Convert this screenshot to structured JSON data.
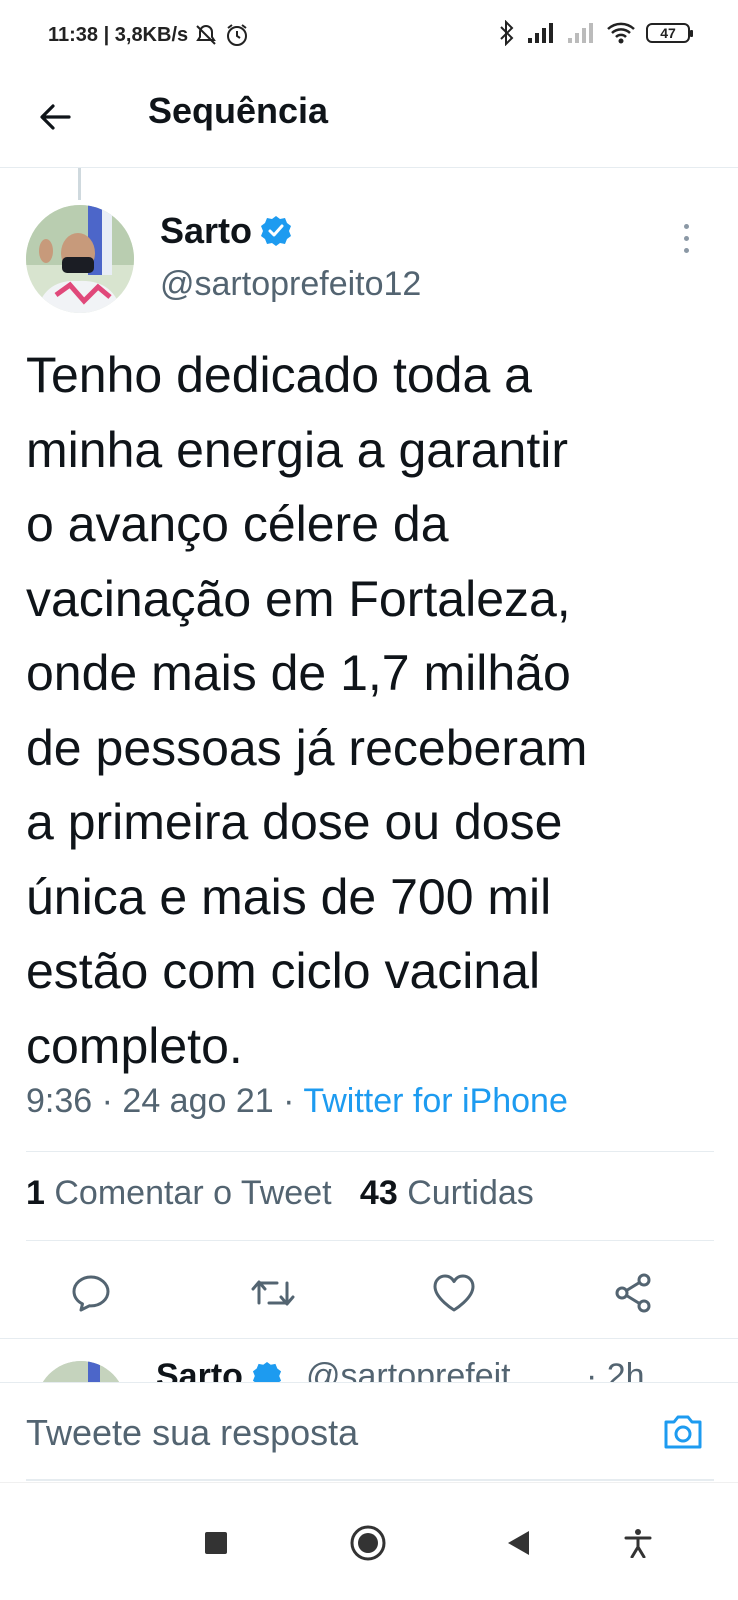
{
  "status_bar": {
    "time_speed": "11:38 | 3,8KB/s",
    "battery": "47"
  },
  "header": {
    "title": "Sequência"
  },
  "tweet": {
    "author_name": "Sarto",
    "author_handle": "@sartoprefeito12",
    "text": "Tenho dedicado toda a minha energia a garantir o avanço célere da vacinação em Fortaleza, onde mais de 1,7 milhão de pessoas já receberam a primeira dose ou dose única e mais de 700 mil estão com ciclo vacinal completo.",
    "lines": [
      "Tenho dedicado toda a",
      "minha energia a garantir",
      "o avanço célere da",
      "vacinação em Fortaleza,",
      "onde mais de 1,7 milhão",
      "de pessoas já receberam",
      "a primeira dose ou dose",
      "única e mais de 700 mil",
      "estão com ciclo vacinal",
      "completo."
    ],
    "time": "9:36",
    "date": "24 ago 21",
    "source": "Twitter for iPhone",
    "separator": "·",
    "replies_count": "1",
    "replies_label": "Comentar o Tweet",
    "likes_count": "43",
    "likes_label": "Curtidas"
  },
  "next_tweet": {
    "author_name": "Sarto",
    "author_handle": "@sartoprefeit...",
    "time": "· 2h"
  },
  "reply": {
    "placeholder": "Tweete sua resposta"
  },
  "colors": {
    "accent": "#1d9bf0",
    "secondary_text": "#536471",
    "primary_text": "#0f1419",
    "divider": "#e6ecf0"
  },
  "icons": {
    "back": "arrow-left-icon",
    "verified": "verified-badge-icon",
    "more": "more-vertical-icon",
    "reply": "reply-icon",
    "retweet": "retweet-icon",
    "like": "heart-icon",
    "share": "share-icon",
    "camera": "camera-icon"
  }
}
